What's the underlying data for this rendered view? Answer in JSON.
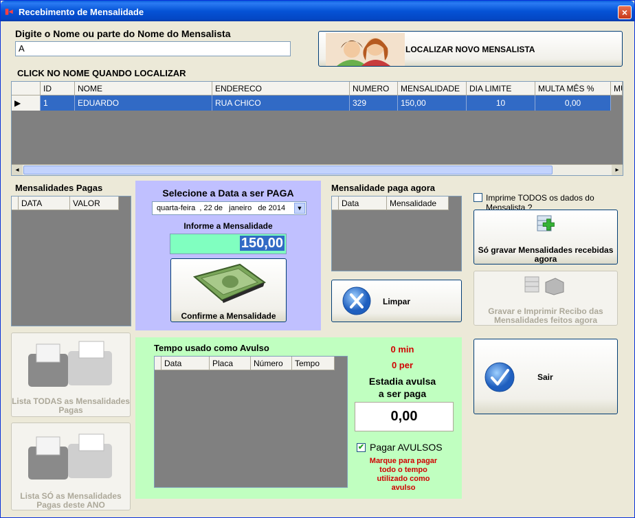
{
  "window": {
    "title": "Recebimento de Mensalidade",
    "close": "×"
  },
  "search": {
    "label": "Digite o Nome ou parte do Nome do Mensalista",
    "value": "A",
    "locate_button": "LOCALIZAR NOVO MENSALISTA"
  },
  "grid_hint": "CLICK NO NOME QUANDO LOCALIZAR",
  "clients": {
    "columns": [
      "ID",
      "NOME",
      "ENDERECO",
      "NUMERO",
      "MENSALIDADE",
      "DIA LIMITE",
      "MULTA MÊS %",
      "MU"
    ],
    "rows": [
      [
        "1",
        "EDUARDO",
        "RUA CHICO",
        "329",
        "150,00",
        "10",
        "0,00",
        ""
      ]
    ]
  },
  "paid": {
    "title": "Mensalidades Pagas",
    "columns": [
      "DATA",
      "VALOR"
    ]
  },
  "date_panel": {
    "title": "Selecione a Data a ser PAGA",
    "date": "quarta-feira  , 22 de   janeiro   de 2014",
    "amount_label": "Informe a Mensalidade",
    "amount": "150,00",
    "confirm_button": "Confirme a Mensalidade"
  },
  "paid_now": {
    "title": "Mensalidade paga agora",
    "columns": [
      "Data",
      "Mensalidade"
    ]
  },
  "print_all": {
    "label": "Imprime TODOS os dados do Mensalista ?"
  },
  "buttons": {
    "save_only": "Só gravar Mensalidades recebidas agora",
    "save_print": "Gravar e Imprimir Recibo das Mensalidades feitos agora",
    "clear": "Limpar",
    "exit": "Sair",
    "list_all": "Lista TODAS as Mensalidades Pagas",
    "list_year": "Lista SÓ as Mensalidades Pagas deste ANO"
  },
  "avulso": {
    "title": "Tempo usado como Avulso",
    "columns": [
      "Data",
      "Placa",
      "Número",
      "Tempo"
    ],
    "minutes": "0 min",
    "periods": "0 per",
    "stay_label_1": "Estadia avulsa",
    "stay_label_2": "a ser paga",
    "stay_value": "0,00",
    "pay_label": "Pagar AVULSOS",
    "hint": "Marque para pagar todo o tempo utilizado como avulso"
  },
  "colors": {
    "title_bar": "#0553d6",
    "selection": "#316ac5",
    "date_panel": "#c0c0ff",
    "avulso_panel": "#c0ffc0",
    "alert": "#d00000",
    "amount_field": "#80ffc0"
  }
}
